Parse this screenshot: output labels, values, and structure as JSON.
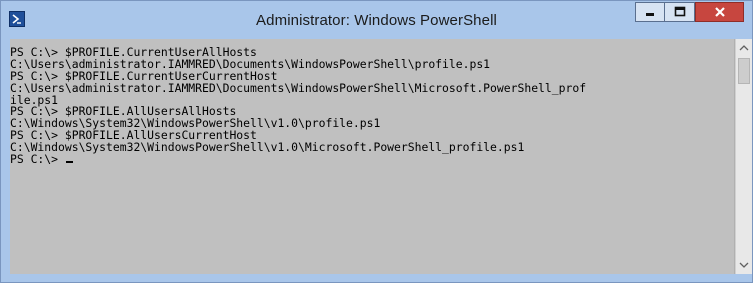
{
  "window": {
    "title": "Administrator: Windows PowerShell",
    "colors": {
      "frame": "#a9c6ea",
      "console_background": "#c0c0c0",
      "console_text": "#000000",
      "close_button": "#c7463f"
    },
    "icons": {
      "app": "powershell-icon",
      "minimize": "minimize-icon",
      "maximize": "maximize-icon",
      "close": "close-icon",
      "scroll_up": "chevron-up-icon",
      "scroll_down": "chevron-down-icon"
    }
  },
  "console": {
    "lines": [
      "PS C:\\> $PROFILE.CurrentUserAllHosts",
      "C:\\Users\\administrator.IAMMRED\\Documents\\WindowsPowerShell\\profile.ps1",
      "PS C:\\> $PROFILE.CurrentUserCurrentHost",
      "C:\\Users\\administrator.IAMMRED\\Documents\\WindowsPowerShell\\Microsoft.PowerShell_prof",
      "ile.ps1",
      "PS C:\\> $PROFILE.AllUsersAllHosts",
      "C:\\Windows\\System32\\WindowsPowerShell\\v1.0\\profile.ps1",
      "PS C:\\> $PROFILE.AllUsersCurrentHost",
      "C:\\Windows\\System32\\WindowsPowerShell\\v1.0\\Microsoft.PowerShell_profile.ps1"
    ],
    "prompt": "PS C:\\> "
  }
}
